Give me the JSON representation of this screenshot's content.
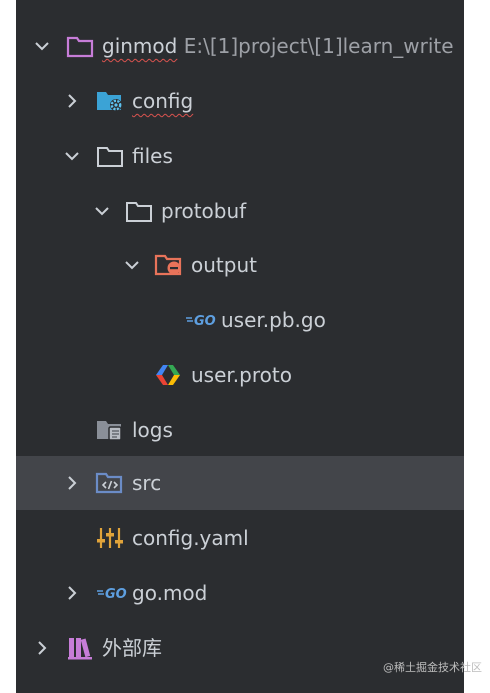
{
  "project_tree": {
    "root": {
      "name": "ginmod",
      "path": "E:\\[1]project\\[1]learn_write"
    },
    "items": [
      {
        "label": "config"
      },
      {
        "label": "files"
      },
      {
        "label": "protobuf"
      },
      {
        "label": "output"
      },
      {
        "label": "user.pb.go"
      },
      {
        "label": "user.proto"
      },
      {
        "label": "logs"
      },
      {
        "label": "src"
      },
      {
        "label": "config.yaml"
      },
      {
        "label": "go.mod"
      },
      {
        "label": "外部库"
      }
    ],
    "selected": "src"
  },
  "watermark": "@稀土掘金技术社区",
  "colors": {
    "panel_bg": "#2b2d30",
    "selected_bg": "#43454a",
    "text": "#cbd0d6",
    "folder_outline": "#cbd0d6",
    "root_folder": "#c77dd8",
    "config_folder": "#3ba3d6",
    "output_folder": "#e8735a",
    "src_folder": "#6b8cc7",
    "go_blue": "#5e9fe0",
    "yaml_orange": "#e0a33a",
    "library": "#c77dd8"
  }
}
